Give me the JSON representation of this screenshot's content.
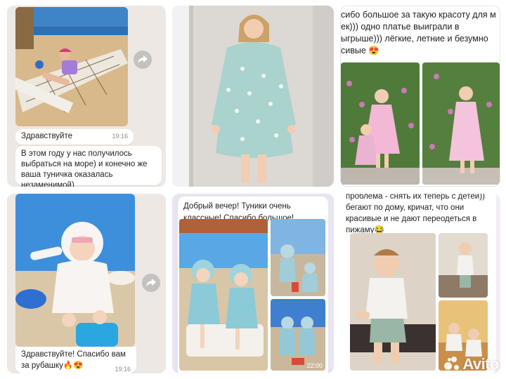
{
  "tiles": {
    "t1": {
      "greeting": "Здравствуйте",
      "greeting_time": "19:16",
      "message": "В этом году у нас получилось выбраться на море) и конечно же ваша туничка оказалась незаменимой)"
    },
    "t3": {
      "message": "сибо большое за такую красоту для м ек))) одно платье выиграли в ыгрыше))) лёгкие, летние и безумно сивые 😍"
    },
    "t4": {
      "message": "Здравствуйте! Спасибо вам за рубашку🔥😍",
      "time": "19:16"
    },
    "t5": {
      "message": "Добрый вечер! Туники очень классные! Спасибо большое!",
      "time": "22:00"
    },
    "t6": {
      "message": "проблема - снять их теперь с детей)) бегают по дому, кричат, что они красивые и не дают переодеться в пижаму😂"
    }
  },
  "watermark": {
    "brand": "Avito"
  },
  "icons": {
    "share": "share-arrow-icon",
    "brand_logo": "avito-logo-icon"
  },
  "colors": {
    "chat_bg": "#eee8e4",
    "bubble": "#ffffff",
    "accent_mint": "#a9d3cc"
  }
}
